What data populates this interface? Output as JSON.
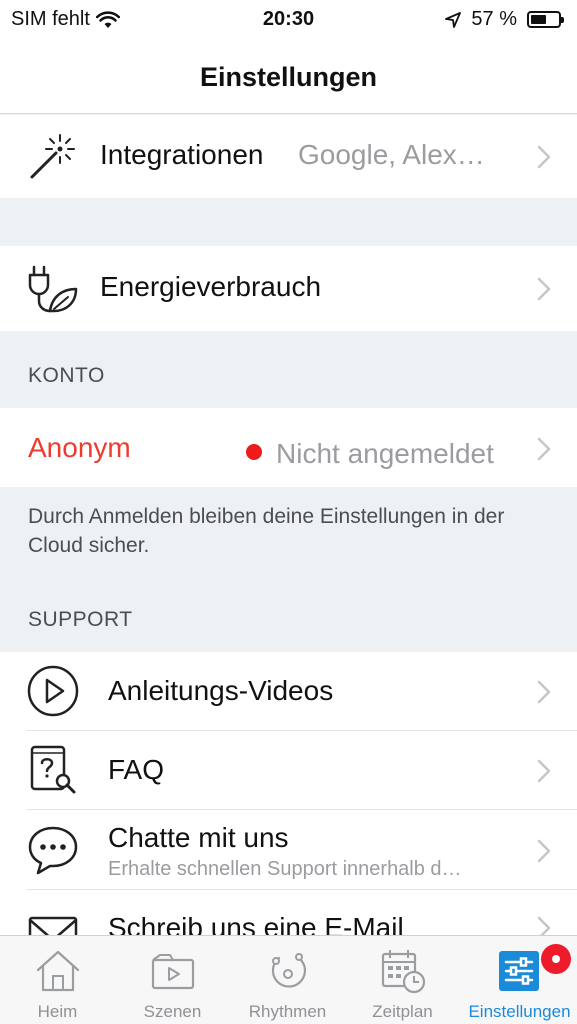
{
  "status_bar": {
    "carrier": "SIM fehlt",
    "time": "20:30",
    "battery": "57 %",
    "battery_level": 0.57
  },
  "nav": {
    "title": "Einstellungen"
  },
  "rows": {
    "integrations": {
      "label": "Integrationen",
      "value": "Google, Alex…",
      "icon": "magic-wand-icon"
    },
    "energy": {
      "label": "Energieverbrauch",
      "icon": "plug-leaf-icon"
    }
  },
  "sections": {
    "account": {
      "header": "KONTO",
      "user_label": "Anonym",
      "user_status": "Nicht angemeldet",
      "footnote": "Durch Anmelden bleiben deine Einstellungen in der Cloud sicher."
    },
    "support": {
      "header": "SUPPORT",
      "items": [
        {
          "label": "Anleitungs-Videos",
          "icon": "play-circle-icon"
        },
        {
          "label": "FAQ",
          "icon": "faq-icon"
        },
        {
          "label": "Chatte mit uns",
          "subtitle": "Erhalte schnellen Support innerhalb d…",
          "icon": "chat-bubble-icon"
        },
        {
          "label": "Schreib uns eine E-Mail",
          "icon": "envelope-icon"
        }
      ]
    }
  },
  "tab_bar": {
    "tabs": [
      {
        "label": "Heim",
        "icon": "home-icon",
        "active": false
      },
      {
        "label": "Szenen",
        "icon": "scenes-icon",
        "active": false
      },
      {
        "label": "Rhythmen",
        "icon": "rhythm-icon",
        "active": false
      },
      {
        "label": "Zeitplan",
        "icon": "calendar-clock-icon",
        "active": false
      },
      {
        "label": "Einstellungen",
        "icon": "settings-sliders-icon",
        "active": true
      }
    ]
  },
  "colors": {
    "accent": "#1b8ad9",
    "danger": "#ee1b1b",
    "background": "#eef1f4",
    "secondary_text": "#9a9ca0"
  }
}
